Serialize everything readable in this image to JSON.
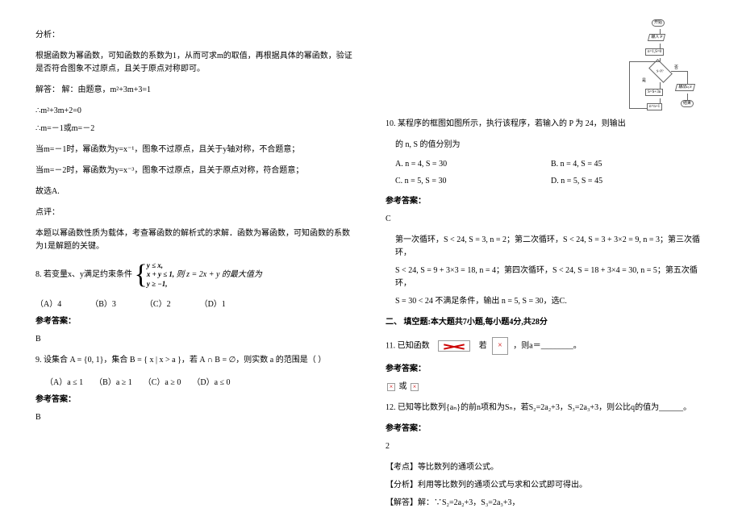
{
  "left": {
    "analysis_h": "分析：",
    "analysis_p1": "根据函数为幂函数，可知函数的系数为1，从而可求m的取值，再根据具体的幂函数，验证是否符合图象不过原点，且关于原点对称即可。",
    "solve_line": "解答：  解：由题意，m²+3m+3=1",
    "eq1": "∴m²+3m+2=0",
    "eq2": "∴m=－1或m=－2",
    "case1": "当m=－1时，幂函数为y=x⁻¹，图象不过原点，且关于y轴对称，不合题意；",
    "case2": "当m=－2时，幂函数为y=x⁻³，图象不过原点，且关于原点对称，符合题意；",
    "so": "故选A.",
    "review_h": "点评：",
    "review_p": "本题以幂函数性质为载体，考查幂函数的解析式的求解．函数为幂函数，可知函数的系数为1是解题的关键。",
    "q8_a": "8. 若变量x、y满足约束条件",
    "q8_b1": "y ≤ x,",
    "q8_b2": "x + y ≤ 1,",
    "q8_b3": "y ≥ −1,",
    "q8_c": "则 z = 2x + y 的最大值为",
    "q8_A": "（A）4",
    "q8_B": "（B）3",
    "q8_C": "（C）2",
    "q8_D": "（D）1",
    "ref": "参考答案：",
    "q8_ans": "B",
    "q9": "9. 设集合 A = {0, 1}，集合 B = { x | x > a }，若 A ∩ B = ∅，则实数 a 的范围是（    ）",
    "q9_A": "（A）a ≤ 1",
    "q9_B": "（B）a ≥ 1",
    "q9_C": "（C）a ≥ 0",
    "q9_D": "（D）a ≤ 0",
    "q9_ans": "B"
  },
  "right": {
    "q10_a": "10. 某程序的框图如图所示，执行该程序，若输入的 P 为 24，则输出",
    "q10_b": "的 n, S 的值分别为",
    "q10_A": "A. n = 4, S = 30",
    "q10_B": "B. n = 4, S = 45",
    "q10_C": "C. n = 5, S = 30",
    "q10_D": "D. n = 5, S = 45",
    "ref": "参考答案：",
    "q10_ans": "C",
    "q10_exp1": "第一次循环，S < 24, S = 3, n = 2；第二次循环，S < 24, S = 3 + 3×2 = 9, n = 3；第三次循环，",
    "q10_exp2": "S < 24, S = 9 + 3×3 = 18, n = 4；第四次循环，S < 24, S = 18 + 3×4 = 30, n = 5；第五次循环，",
    "q10_exp3": "S = 30 < 24 不满足条件，输出 n = 5, S = 30，选C.",
    "sec2": "二、 填空题:本大题共7小题,每小题4分,共28分",
    "q11_a": "11. 已知函数",
    "q11_b": "若",
    "q11_c": "，则a＝________。",
    "q11_ans": "或",
    "q12": "12. 已知等比数列{aₙ}的前n项和为Sₙ，若S₂=2a₂+3，S₃=2a₃+3，则公比q的值为______。",
    "q12_ans": "2",
    "q12_kd": "【考点】等比数列的通项公式。",
    "q12_fx": "【分析】利用等比数列的通项公式与求和公式即可得出。",
    "q12_jd": "【解答】解：∵S₂=2a₂+3，S₃=2a₃+3，",
    "fc": {
      "start": "开始",
      "in": "输入 P",
      "init": "n=1,S=0",
      "cond": "S<P?",
      "yes": "是",
      "no": "否",
      "step1": "S=S+3n",
      "step2": "n=n+1",
      "out": "输出n,S",
      "end": "结束"
    }
  }
}
